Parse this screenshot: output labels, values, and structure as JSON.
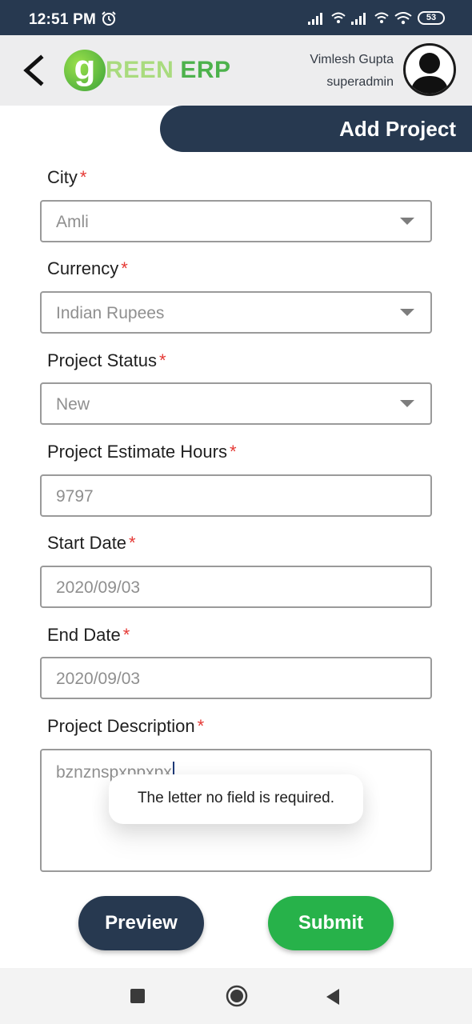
{
  "status_bar": {
    "time": "12:51 PM",
    "alarm_icon": "alarm-clock-icon",
    "battery": "53"
  },
  "header": {
    "back_icon": "chevron-left-icon",
    "logo": {
      "letter": "g",
      "reen": "REEN",
      "erp": "ERP"
    },
    "user_name": "Vimlesh Gupta",
    "user_role": "superadmin"
  },
  "page_title": "Add Project",
  "form": {
    "city": {
      "label": "City",
      "value": "Amli"
    },
    "currency": {
      "label": "Currency",
      "value": "Indian Rupees"
    },
    "project_status": {
      "label": "Project Status",
      "value": "New"
    },
    "estimate_hours": {
      "label": "Project Estimate Hours",
      "value": "9797"
    },
    "start_date": {
      "label": "Start Date",
      "value": "2020/09/03"
    },
    "end_date": {
      "label": "End Date",
      "value": "2020/09/03"
    },
    "description": {
      "label": "Project Description",
      "value": "bznznspxppxpx"
    },
    "required_mark": "*"
  },
  "toast": "The letter no field is required.",
  "buttons": {
    "preview": "Preview",
    "submit": "Submit"
  },
  "colors": {
    "navy": "#273950",
    "green": "#27b24a",
    "required": "#e53935"
  }
}
